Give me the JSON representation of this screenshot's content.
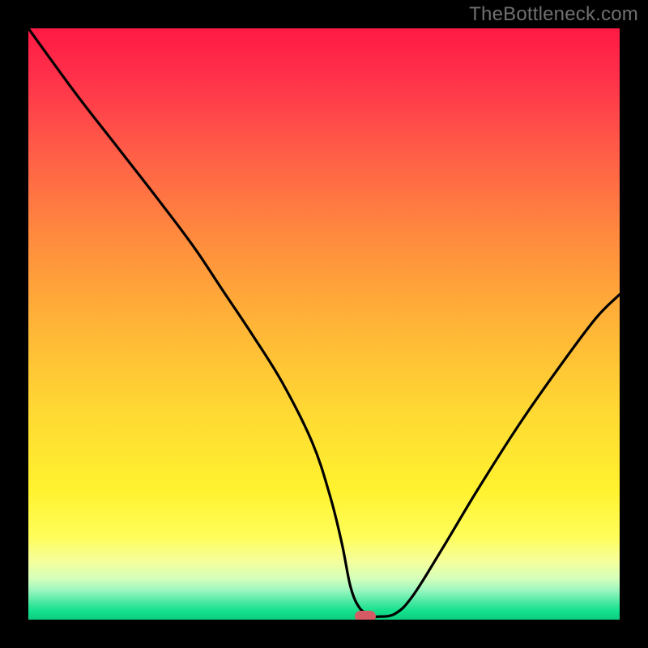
{
  "watermark": "TheBottleneck.com",
  "chart_data": {
    "type": "line",
    "title": "",
    "xlabel": "",
    "ylabel": "",
    "xlim": [
      0,
      100
    ],
    "ylim": [
      0,
      100
    ],
    "grid": false,
    "legend": false,
    "series": [
      {
        "name": "bottleneck-curve",
        "x": [
          0,
          8,
          15,
          22,
          28,
          33,
          38,
          43,
          48,
          51,
          53,
          54.5,
          56,
          57.5,
          58.5,
          59,
          62,
          65,
          70,
          76,
          83,
          90,
          96,
          100
        ],
        "y": [
          100,
          89,
          80,
          71,
          63,
          55.5,
          48,
          40,
          30,
          21,
          13,
          5.5,
          2,
          1,
          0.5,
          0.5,
          1,
          4,
          12,
          22,
          33,
          43,
          51,
          55
        ]
      }
    ],
    "marker": {
      "x": 57,
      "y": 0.5
    },
    "gradient_stops": [
      {
        "pct": 0,
        "color": "#ff1a44"
      },
      {
        "pct": 50,
        "color": "#ffb437"
      },
      {
        "pct": 86,
        "color": "#fffd5a"
      },
      {
        "pct": 100,
        "color": "#0cce7f"
      }
    ]
  }
}
